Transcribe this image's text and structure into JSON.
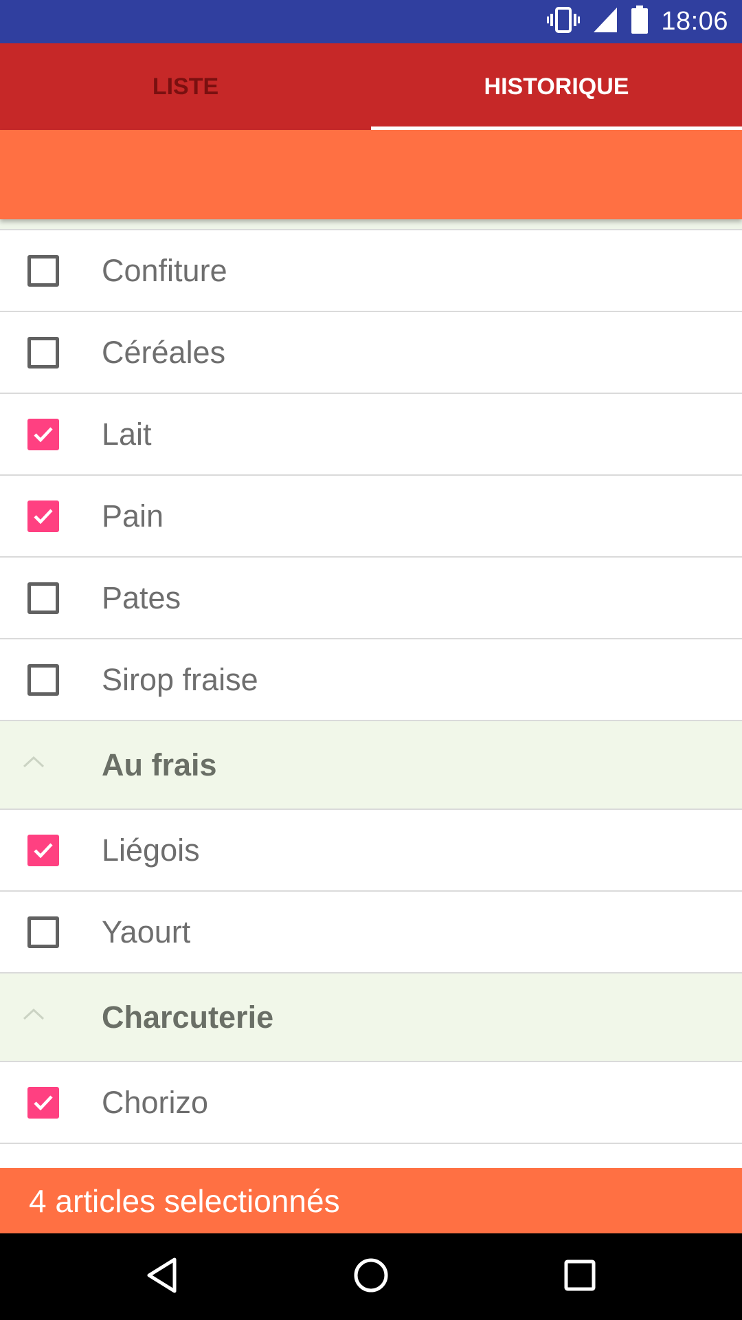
{
  "status_bar": {
    "time": "18:06",
    "icons": [
      "vibrate-icon",
      "signal-icon",
      "battery-icon"
    ],
    "background": "#303F9F"
  },
  "tabs": [
    {
      "label": "LISTE",
      "active": false
    },
    {
      "label": "HISTORIQUE",
      "active": true
    }
  ],
  "colors": {
    "tab_bar": "#C62828",
    "accent": "#FF7043",
    "checkbox_checked": "#FF4081",
    "section_bg": "#F1F7E9"
  },
  "list": {
    "items": [
      {
        "label": "Confiture",
        "checked": false
      },
      {
        "label": "Céréales",
        "checked": false
      },
      {
        "label": "Lait",
        "checked": true
      },
      {
        "label": "Pain",
        "checked": true
      },
      {
        "label": "Pates",
        "checked": false
      },
      {
        "label": "Sirop fraise",
        "checked": false
      }
    ],
    "sections": [
      {
        "title": "Au frais",
        "icon": "chevron-up-icon",
        "items": [
          {
            "label": "Liégois",
            "checked": true
          },
          {
            "label": "Yaourt",
            "checked": false
          }
        ]
      },
      {
        "title": "Charcuterie",
        "icon": "chevron-up-icon",
        "items": [
          {
            "label": "Chorizo",
            "checked": true
          }
        ]
      }
    ]
  },
  "footer": {
    "selection_text": "4 articles selectionnés"
  },
  "nav_bar": {
    "buttons": [
      "back-icon",
      "home-icon",
      "recents-icon"
    ]
  }
}
